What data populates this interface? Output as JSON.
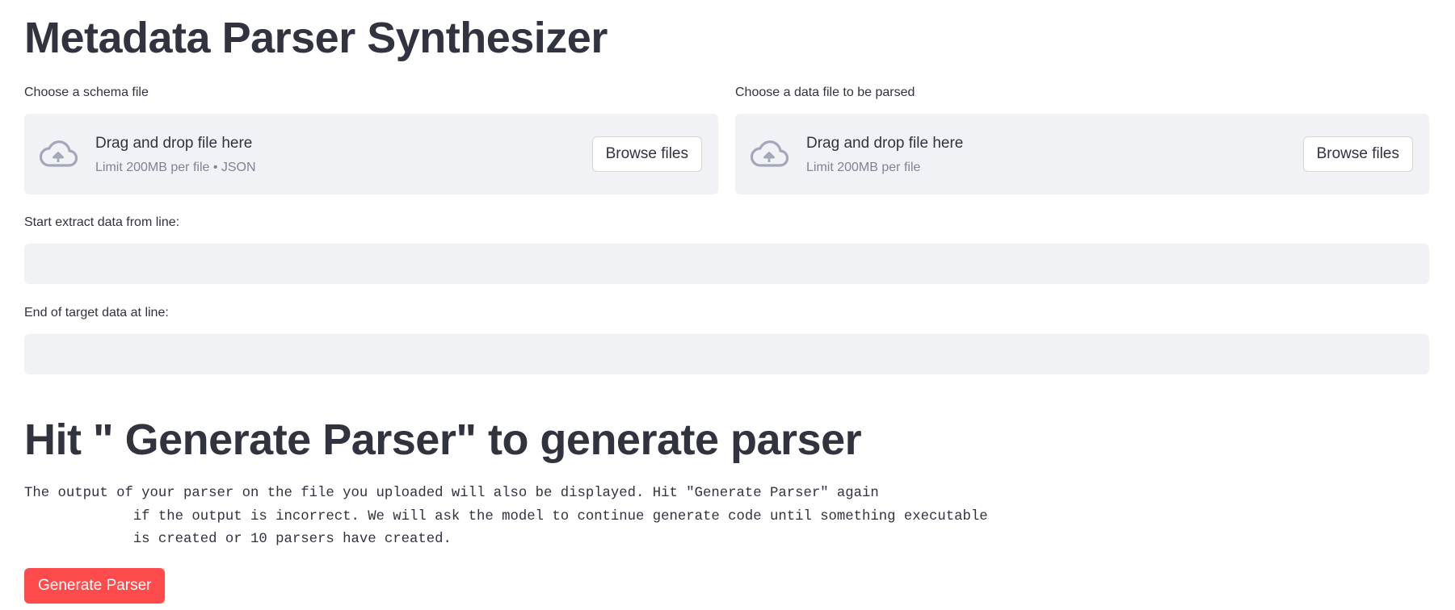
{
  "page": {
    "title": "Metadata Parser Synthesizer"
  },
  "schema_upload": {
    "label": "Choose a schema file",
    "dropzone_title": "Drag and drop file here",
    "dropzone_limit": "Limit 200MB per file • JSON",
    "browse_label": "Browse files",
    "icon": "cloud-upload-icon"
  },
  "data_upload": {
    "label": "Choose a data file to be parsed",
    "dropzone_title": "Drag and drop file here",
    "dropzone_limit": "Limit 200MB per file",
    "browse_label": "Browse files",
    "icon": "cloud-upload-icon"
  },
  "start_line": {
    "label": "Start extract data from line:",
    "value": ""
  },
  "end_line": {
    "label": "End of target data at line:",
    "value": ""
  },
  "generate_section": {
    "heading": "Hit \" Generate Parser\" to generate parser",
    "description": "The output of your parser on the file you uploaded will also be displayed. Hit \"Generate Parser\" again\n             if the output is incorrect. We will ask the model to continue generate code until something executable\n             is created or 10 parsers have created.",
    "button_label": "Generate Parser"
  },
  "colors": {
    "primary": "#ff4b4b",
    "text": "#31333f",
    "muted_text": "#808495",
    "input_bg": "#f0f2f6",
    "icon": "#a3a8b8"
  }
}
